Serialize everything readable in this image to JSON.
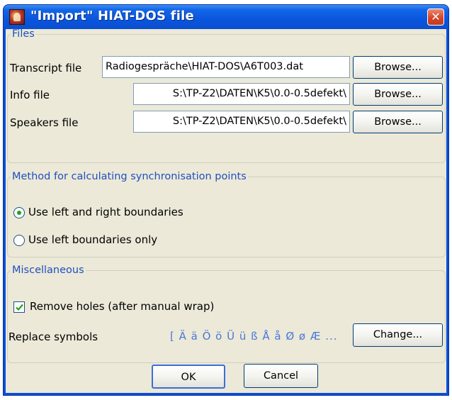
{
  "window": {
    "title": "\"Import\" HIAT-DOS file",
    "close_glyph": "✕",
    "app_icon": "app-logo-icon"
  },
  "files": {
    "legend": "Files",
    "transcript": {
      "label": "Transcript file",
      "value": "Radiogespräche\\HIAT-DOS\\A6T003.dat",
      "button": "Browse..."
    },
    "info": {
      "label": "Info file",
      "value": "S:\\TP-Z2\\DATEN\\K5\\0.0-0.5defekt\\",
      "button": "Browse..."
    },
    "speakers": {
      "label": "Speakers file",
      "value": "S:\\TP-Z2\\DATEN\\K5\\0.0-0.5defekt\\",
      "button": "Browse..."
    }
  },
  "method": {
    "legend": "Method for calculating synchronisation points",
    "options": [
      {
        "label": "Use left and right boundaries",
        "selected": true
      },
      {
        "label": "Use left boundaries only",
        "selected": false
      }
    ]
  },
  "misc": {
    "legend": "Miscellaneous",
    "remove_holes": {
      "label": "Remove holes (after manual wrap)",
      "checked": true
    },
    "replace": {
      "label": "Replace symbols",
      "symbols": "[ Ä ä Ö ö Ü ü ß Å å Ø ø Æ ...",
      "button": "Change..."
    }
  },
  "footer": {
    "ok": "OK",
    "cancel": "Cancel"
  },
  "colors": {
    "titlebar": "#0a55dc",
    "legend": "#1f4fbf",
    "dialog_bg": "#ece9d8",
    "radio_dot": "#21a121",
    "check": "#21a121"
  }
}
